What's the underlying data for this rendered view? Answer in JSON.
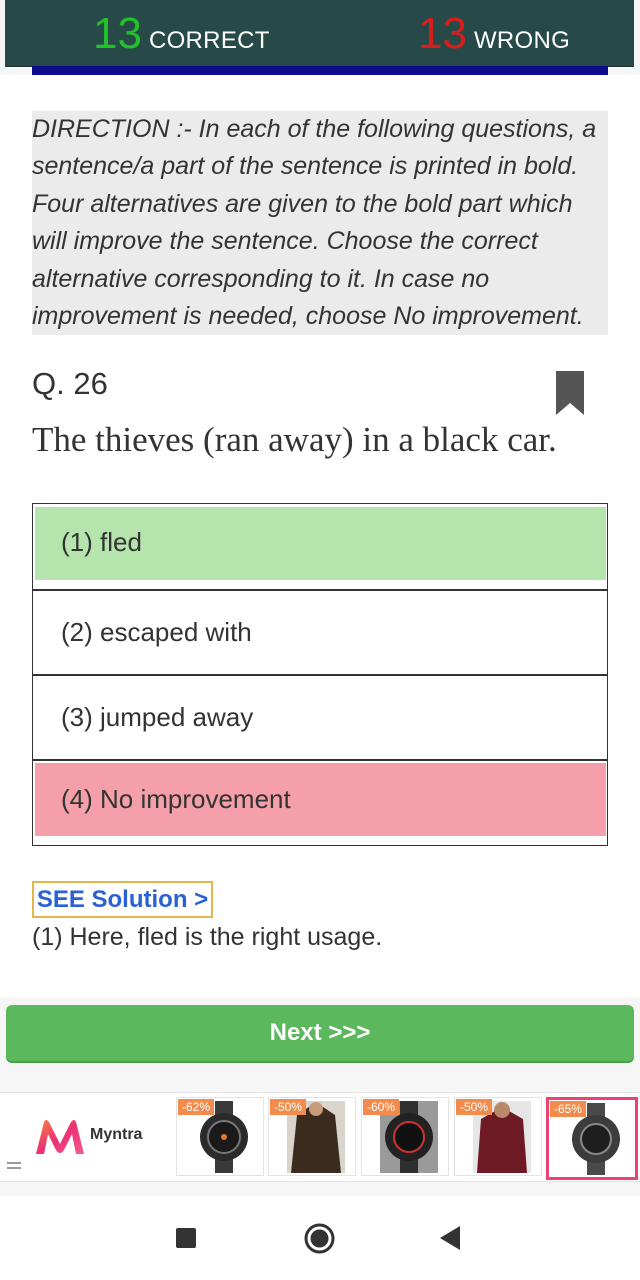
{
  "score": {
    "correct_count": "13",
    "correct_label": "CORRECT",
    "wrong_count": "13",
    "wrong_label": "WRONG"
  },
  "direction_lines": [
    "DIRECTION :- In each of the following questions, a",
    "sentence/a part of the sentence is printed in bold.",
    "Four alternatives are given to the bold part which",
    "will improve the sentence. Choose the correct",
    "alternative corresponding to it. In case no",
    "improvement is needed, choose No improvement."
  ],
  "question": {
    "number_label": "Q. 26",
    "text": "The thieves (ran away) in a black car.",
    "bookmark_icon": "bookmark-icon"
  },
  "options": [
    {
      "label": "(1) fled",
      "state": "correct"
    },
    {
      "label": "(2) escaped with",
      "state": "neutral"
    },
    {
      "label": "(3) jumped away",
      "state": "neutral"
    },
    {
      "label": "(4) No improvement",
      "state": "wrong"
    }
  ],
  "solution": {
    "button_label": "SEE Solution >",
    "text": "(1) Here, fled is the right usage."
  },
  "next_button_label": "Next >>>",
  "ad": {
    "brand": "Myntra",
    "products": [
      {
        "discount": "-62%",
        "kind": "watch"
      },
      {
        "discount": "-50%",
        "kind": "shirt"
      },
      {
        "discount": "-60%",
        "kind": "watch"
      },
      {
        "discount": "-50%",
        "kind": "shirt"
      },
      {
        "discount": "-65%",
        "kind": "watch"
      }
    ]
  },
  "colors": {
    "header_bg": "#274a49",
    "correct_green": "#22c12a",
    "wrong_red": "#d91c1c",
    "correct_option": "#b5e4ad",
    "wrong_option": "#f59faa",
    "next_button": "#5cb85c"
  }
}
